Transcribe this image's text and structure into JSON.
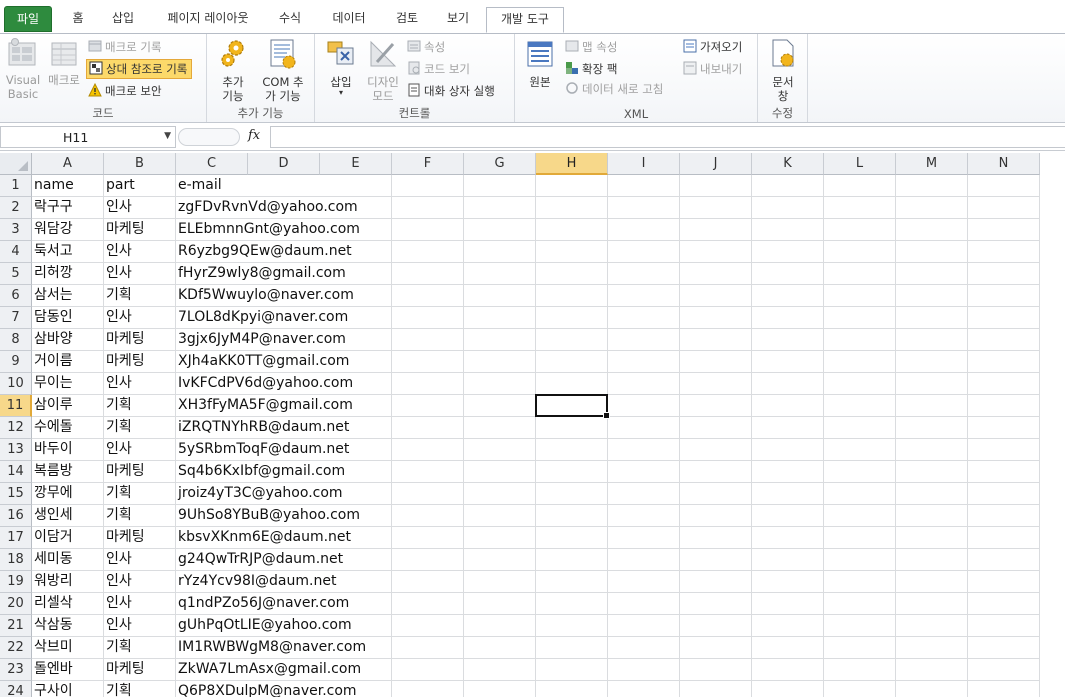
{
  "ribbon_tabs": [
    {
      "label": "파일"
    },
    {
      "label": "홈"
    },
    {
      "label": "삽입"
    },
    {
      "label": "페이지 레이아웃"
    },
    {
      "label": "수식"
    },
    {
      "label": "데이터"
    },
    {
      "label": "검토"
    },
    {
      "label": "보기"
    },
    {
      "label": "개발 도구"
    }
  ],
  "active_tab": "개발 도구",
  "groups": {
    "code": {
      "label": "코드",
      "visual_basic": "Visual Basic",
      "macro": "매크로",
      "record_macro": "매크로 기록",
      "relative_ref": "상대 참조로 기록",
      "macro_security": "매크로 보안"
    },
    "addins": {
      "label": "추가 기능",
      "addins": "추가 기능",
      "com_addins": "COM 추가 기능"
    },
    "controls": {
      "label": "컨트롤",
      "insert": "삽입",
      "design_mode": "디자인 모드",
      "properties": "속성",
      "view_code": "코드 보기",
      "run_dialog": "대화 상자 실행"
    },
    "xml": {
      "label": "XML",
      "source": "원본",
      "map_properties": "맵 속성",
      "expansion_packs": "확장 팩",
      "refresh_data": "데이터 새로 고침",
      "import": "가져오기",
      "export": "내보내기"
    },
    "modify": {
      "label": "수정",
      "document_panel": "문서 창"
    }
  },
  "formula_bar": {
    "name_box": "H11",
    "fx": "fx",
    "formula": ""
  },
  "columns": [
    "A",
    "B",
    "C",
    "D",
    "E",
    "F",
    "G",
    "H",
    "I",
    "J",
    "K",
    "L",
    "M",
    "N"
  ],
  "selected_cell": "H11",
  "rows": [
    {
      "n": "1",
      "a": "name",
      "b": "part",
      "c": "e-mail"
    },
    {
      "n": "2",
      "a": "락구구",
      "b": "인사",
      "c": "zgFDvRvnVd@yahoo.com"
    },
    {
      "n": "3",
      "a": "워담강",
      "b": "마케팅",
      "c": "ELEbmnnGnt@yahoo.com"
    },
    {
      "n": "4",
      "a": "둑서고",
      "b": "인사",
      "c": "R6yzbg9QEw@daum.net"
    },
    {
      "n": "5",
      "a": "리허깡",
      "b": "인사",
      "c": "fHyrZ9wly8@gmail.com"
    },
    {
      "n": "6",
      "a": "삼서는",
      "b": "기획",
      "c": "KDf5Wwuylo@naver.com"
    },
    {
      "n": "7",
      "a": "담동인",
      "b": "인사",
      "c": "7LOL8dKpyi@naver.com"
    },
    {
      "n": "8",
      "a": "삼바양",
      "b": "마케팅",
      "c": "3gjx6JyM4P@naver.com"
    },
    {
      "n": "9",
      "a": "거이름",
      "b": "마케팅",
      "c": "XJh4aKK0TT@gmail.com"
    },
    {
      "n": "10",
      "a": "무이는",
      "b": "인사",
      "c": "IvKFCdPV6d@yahoo.com"
    },
    {
      "n": "11",
      "a": "삼이루",
      "b": "기획",
      "c": "XH3fFyMA5F@gmail.com"
    },
    {
      "n": "12",
      "a": "수에돌",
      "b": "기획",
      "c": "iZRQTNYhRB@daum.net"
    },
    {
      "n": "13",
      "a": "바두이",
      "b": "인사",
      "c": "5ySRbmToqF@daum.net"
    },
    {
      "n": "14",
      "a": "복름방",
      "b": "마케팅",
      "c": "Sq4b6KxIbf@gmail.com"
    },
    {
      "n": "15",
      "a": "깡무에",
      "b": "기획",
      "c": "jroiz4yT3C@yahoo.com"
    },
    {
      "n": "16",
      "a": "생인세",
      "b": "기획",
      "c": "9UhSo8YBuB@yahoo.com"
    },
    {
      "n": "17",
      "a": "이담거",
      "b": "마케팅",
      "c": "kbsvXKnm6E@daum.net"
    },
    {
      "n": "18",
      "a": "세미동",
      "b": "인사",
      "c": "g24QwTrRJP@daum.net"
    },
    {
      "n": "19",
      "a": "워방리",
      "b": "인사",
      "c": "rYz4Ycv98I@daum.net"
    },
    {
      "n": "20",
      "a": "리셀삭",
      "b": "인사",
      "c": "q1ndPZo56J@naver.com"
    },
    {
      "n": "21",
      "a": "삭삼동",
      "b": "인사",
      "c": "gUhPqOtLIE@yahoo.com"
    },
    {
      "n": "22",
      "a": "삭브미",
      "b": "기획",
      "c": "IM1RWBWgM8@naver.com"
    },
    {
      "n": "23",
      "a": "돌엔바",
      "b": "마케팅",
      "c": "ZkWA7LmAsx@gmail.com"
    },
    {
      "n": "24",
      "a": "구사이",
      "b": "기획",
      "c": "Q6P8XDulpM@naver.com"
    }
  ]
}
